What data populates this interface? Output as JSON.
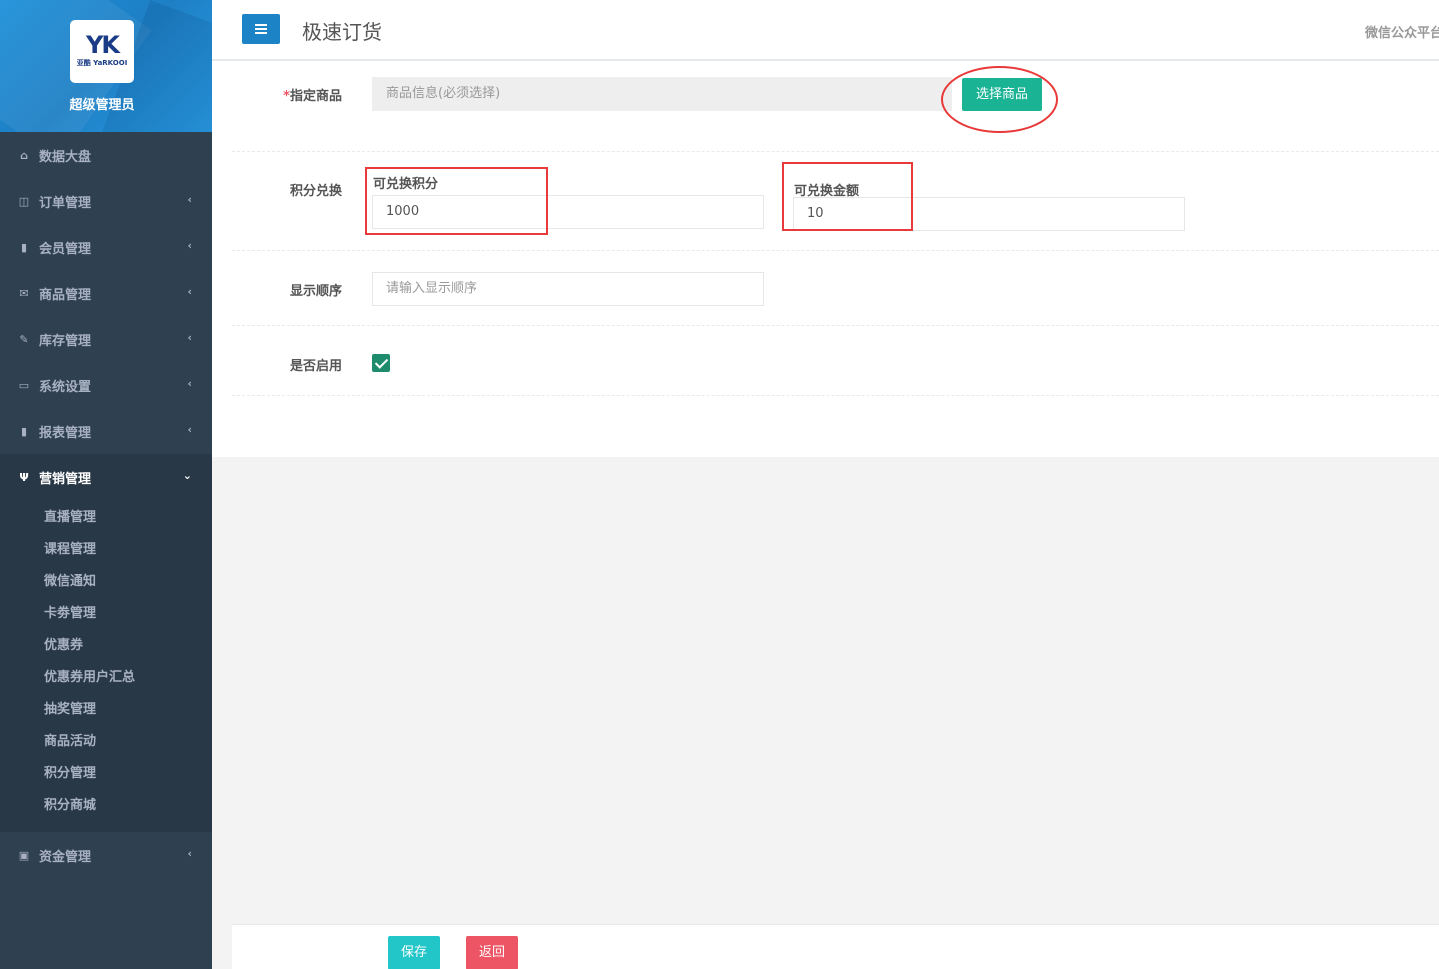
{
  "sidebar": {
    "logo_text": "亚酷 YaRKOOI",
    "logo_mark": "YK",
    "role": "超级管理员",
    "items": [
      {
        "label": "数据大盘",
        "icon": "home-icon"
      },
      {
        "label": "订单管理",
        "icon": "columns-icon"
      },
      {
        "label": "会员管理",
        "icon": "bar-chart-icon"
      },
      {
        "label": "商品管理",
        "icon": "envelope-icon"
      },
      {
        "label": "库存管理",
        "icon": "edit-icon"
      },
      {
        "label": "系统设置",
        "icon": "desktop-icon"
      },
      {
        "label": "报表管理",
        "icon": "bar-chart-icon"
      },
      {
        "label": "营销管理",
        "icon": "cutlery-icon"
      },
      {
        "label": "资金管理",
        "icon": "money-icon"
      }
    ],
    "submenu": [
      "直播管理",
      "课程管理",
      "微信通知",
      "卡劵管理",
      "优惠券",
      "优惠券用户汇总",
      "抽奖管理",
      "商品活动",
      "积分管理",
      "积分商城"
    ]
  },
  "header": {
    "title": "极速订货",
    "right_text": "微信公众平台"
  },
  "form": {
    "product_label": "指定商品",
    "required_mark": "*",
    "product_placeholder": "商品信息(必须选择)",
    "select_product_button": "选择商品",
    "points_label": "积分兑换",
    "points_sub_label": "可兑换积分",
    "points_value": "1000",
    "amount_sub_label": "可兑换金额",
    "amount_value": "10",
    "order_label": "显示顺序",
    "order_placeholder": "请输入显示顺序",
    "enabled_label": "是否启用",
    "enabled": true
  },
  "footer": {
    "save_label": "保存",
    "back_label": "返回"
  },
  "colors": {
    "sidebar_bg": "#2f4050",
    "primary_blue": "#1c84c6",
    "green": "#1ab394",
    "cyan": "#23c6c8",
    "red": "#ed5565",
    "annotation_red": "#e83a3a"
  }
}
